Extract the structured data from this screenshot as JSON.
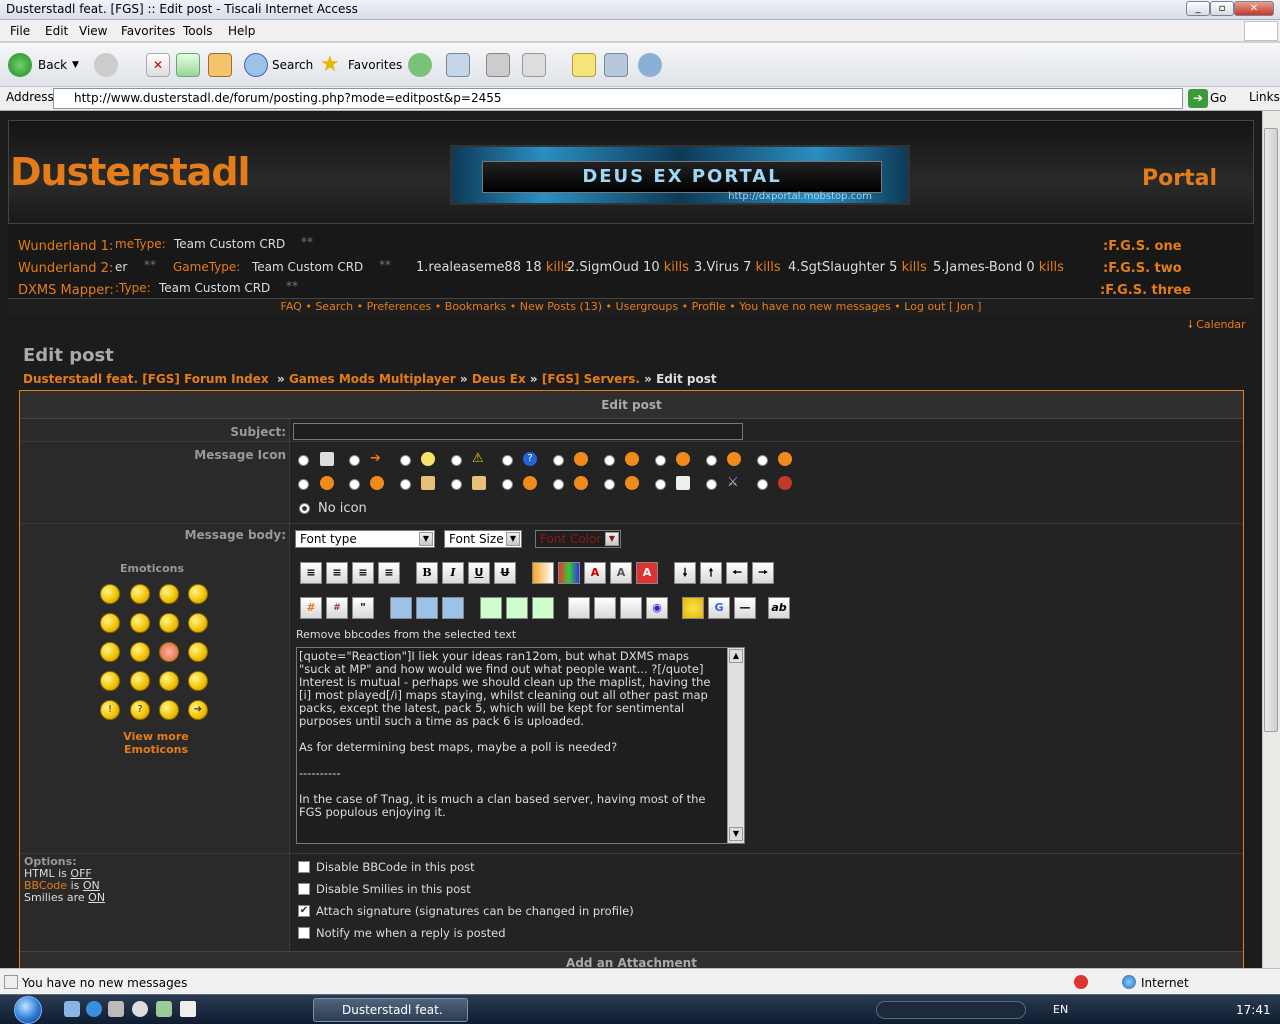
{
  "window": {
    "title": "Dusterstadl feat. [FGS] :: Edit post - Tiscali Internet Access"
  },
  "menu": [
    "File",
    "Edit",
    "View",
    "Favorites",
    "Tools",
    "Help"
  ],
  "toolbar": {
    "back": "Back",
    "search": "Search",
    "favorites": "Favorites"
  },
  "address": {
    "label": "Address",
    "url": "http://www.dusterstadl.de/forum/posting.php?mode=editpost&p=2455",
    "go": "Go",
    "links": "Links"
  },
  "header": {
    "logo": "Dusterstadl",
    "banner_title": "DEUS EX PORTAL",
    "banner_url": "http://dxportal.mobstop.com",
    "portal": "Portal"
  },
  "servers": {
    "rows": [
      {
        "label": "Wunderland 1:",
        "fgs": ":F.G.S. one",
        "prefix": "meType:",
        "mode": "Team Custom CRD",
        "stars": "**"
      },
      {
        "label": "Wunderland 2:",
        "fgs": ":F.G.S. two",
        "prefix": "er",
        "stars1": "**",
        "gametype": "GameType:",
        "mode": "Team Custom CRD",
        "stars2": "**"
      },
      {
        "label": "DXMS Mapper:",
        "fgs": ":F.G.S. three",
        "prefix": ":Type:",
        "mode": "Team Custom CRD",
        "stars": "**"
      }
    ],
    "scores": [
      {
        "name": "1.realeaseme88",
        "kills": "18",
        "unit": "kills"
      },
      {
        "name": "2.SigmOud",
        "kills": "10",
        "unit": "kills"
      },
      {
        "name": "3.Virus",
        "kills": "7",
        "unit": "kills"
      },
      {
        "name": "4.SgtSlaughter",
        "kills": "5",
        "unit": "kills"
      },
      {
        "name": "5.James-Bond",
        "kills": "0",
        "unit": "kills"
      }
    ]
  },
  "nav": [
    "FAQ",
    "Search",
    "Preferences",
    "Bookmarks",
    "New Posts (13)",
    "Usergroups",
    "Profile",
    "You have no new messages",
    "Log out [ Jon ]"
  ],
  "calendar": "Calendar",
  "page": {
    "title": "Edit post"
  },
  "breadcrumb": [
    "Dusterstadl feat. [FGS] Forum Index",
    "Games Mods Multiplayer",
    "Deus Ex",
    "[FGS] Servers.",
    "Edit post"
  ],
  "form": {
    "header": "Edit post",
    "subject_label": "Subject:",
    "subject_value": "",
    "icon_label": "Message Icon",
    "no_icon": "No icon",
    "body_label": "Message body:",
    "emoticons_title": "Emoticons",
    "view_more": "View more",
    "view_more2": "Emoticons",
    "font_type": "Font type",
    "font_size": "Font Size",
    "font_color": "Font Color",
    "remove_bbcodes": "Remove bbcodes from the selected text",
    "message": "[quote=\"Reaction\"]I liek your ideas ran12om, but what DXMS maps \"suck at MP\" and how would we find out what people want... ?[/quote]\nInterest is mutual - perhaps we should clean up the maplist, having the [i] most played[/i] maps staying, whilst cleaning out all other past map packs, except the latest, pack 5, which will be kept for sentimental purposes until such a time as pack 6 is uploaded.\n\nAs for determining best maps, maybe a poll is needed?\n\n----------\n\nIn the case of Tnag, it is much a clan based server, having most of the FGS populous enjoying it.",
    "options_label": "Options:",
    "html_is": "HTML is",
    "html_val": "OFF",
    "bbcode": "BBCode",
    "bbcode_is": "is",
    "bbcode_val": "ON",
    "smilies_are": "Smilies are",
    "smilies_val": "ON",
    "checkboxes": [
      {
        "label": "Disable BBCode in this post",
        "checked": false
      },
      {
        "label": "Disable Smilies in this post",
        "checked": false
      },
      {
        "label": "Attach signature (signatures can be changed in profile)",
        "checked": true
      },
      {
        "label": "Notify me when a reply is posted",
        "checked": false
      }
    ],
    "attachment_header": "Add an Attachment"
  },
  "status": {
    "text": "You have no new messages",
    "zone": "Internet"
  },
  "taskbar": {
    "task": "Dusterstadl feat. [FG...",
    "lang": "EN",
    "clock": "17:41"
  }
}
